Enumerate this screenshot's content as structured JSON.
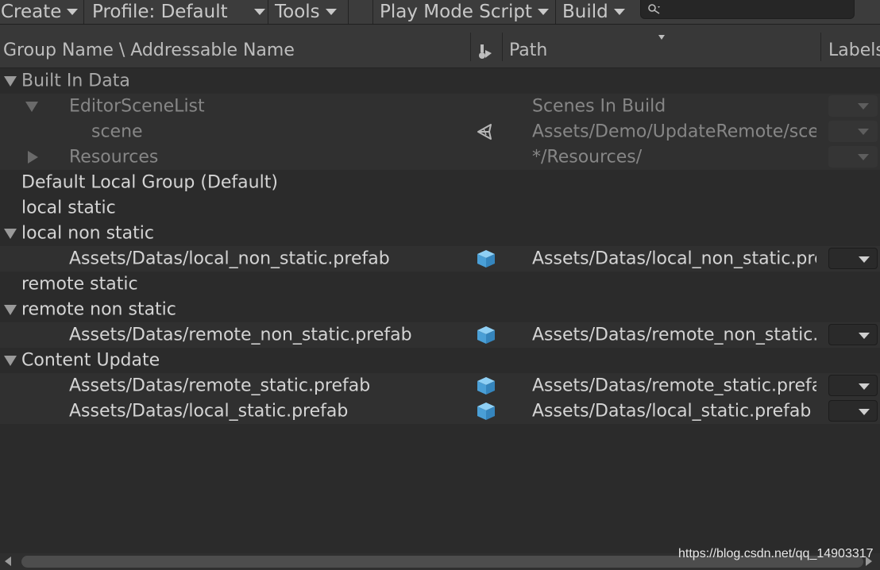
{
  "toolbar": {
    "create_label": "Create",
    "profile_label": "Profile: Default",
    "tools_label": "Tools",
    "play_mode_label": "Play Mode Script",
    "build_label": "Build",
    "search_placeholder": "",
    "search_icon": "search-icon"
  },
  "columns": {
    "group_name": "Group Name \\ Addressable Name",
    "type_icon": "type-icon",
    "path": "Path",
    "labels": "Labels"
  },
  "rows": [
    {
      "kind": "group",
      "label": "Built In Data",
      "expanded": true,
      "dim": false
    },
    {
      "kind": "entry",
      "label": "EditorSceneList",
      "path": "Scenes In Build",
      "expanded": true,
      "dim": true,
      "icon": "",
      "label_enabled": false
    },
    {
      "kind": "entry",
      "label": "scene",
      "path": "Assets/Demo/UpdateRemote/scene.unity",
      "dim": true,
      "icon": "unity-scene-icon",
      "label_enabled": false
    },
    {
      "kind": "entry",
      "label": "Resources",
      "path": "*/Resources/",
      "expanded": false,
      "dim": true,
      "icon": "",
      "label_enabled": false
    },
    {
      "kind": "group",
      "label": "Default Local Group (Default)",
      "dim": false
    },
    {
      "kind": "group",
      "label": "local static",
      "dim": false
    },
    {
      "kind": "group",
      "label": "local non static",
      "expanded": true,
      "dim": false
    },
    {
      "kind": "entry",
      "label": "Assets/Datas/local_non_static.prefab",
      "path": "Assets/Datas/local_non_static.prefab",
      "dim": false,
      "icon": "prefab-cube-icon",
      "label_enabled": true
    },
    {
      "kind": "group",
      "label": "remote static",
      "dim": false
    },
    {
      "kind": "group",
      "label": "remote non static",
      "expanded": true,
      "dim": false
    },
    {
      "kind": "entry",
      "label": "Assets/Datas/remote_non_static.prefab",
      "path": "Assets/Datas/remote_non_static.prefab",
      "dim": false,
      "icon": "prefab-cube-icon",
      "label_enabled": true
    },
    {
      "kind": "group",
      "label": "Content Update",
      "expanded": true,
      "dim": false
    },
    {
      "kind": "entry",
      "label": "Assets/Datas/remote_static.prefab",
      "path": "Assets/Datas/remote_static.prefab",
      "dim": false,
      "icon": "prefab-cube-icon",
      "label_enabled": true
    },
    {
      "kind": "entry",
      "label": "Assets/Datas/local_static.prefab",
      "path": "Assets/Datas/local_static.prefab",
      "dim": false,
      "icon": "prefab-cube-icon",
      "label_enabled": true
    }
  ],
  "watermark": "https://blog.csdn.net/qq_14903317",
  "colors": {
    "background": "#2b2b2b",
    "toolbar": "#3c3c3c",
    "header": "#383838",
    "prefab_icon": "#5aa9dd"
  }
}
